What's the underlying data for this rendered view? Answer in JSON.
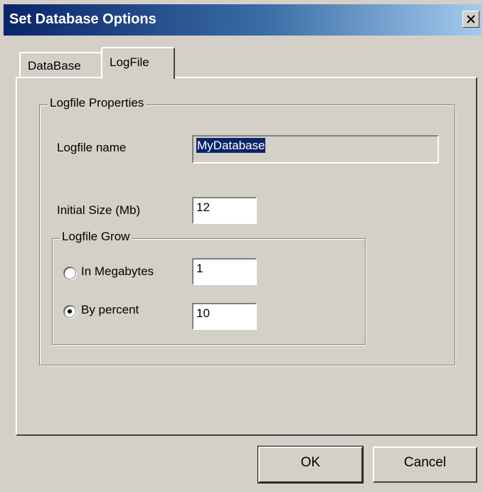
{
  "window": {
    "title": "Set Database Options",
    "close_glyph": "×"
  },
  "tabs": [
    {
      "label": "DataBase",
      "active": false
    },
    {
      "label": "LogFile",
      "active": true
    }
  ],
  "logfile_properties": {
    "group_label": "Logfile Properties",
    "name_label": "Logfile name",
    "name_value": "MyDatabase",
    "size_label": "Initial Size (Mb)",
    "size_value": "12"
  },
  "logfile_grow": {
    "group_label": "Logfile Grow",
    "options": [
      {
        "label": "In Megabytes",
        "value": "1",
        "selected": false
      },
      {
        "label": "By percent",
        "value": "10",
        "selected": true
      }
    ]
  },
  "buttons": {
    "ok": "OK",
    "cancel": "Cancel"
  },
  "colors": {
    "titlebar_start": "#0a246a",
    "titlebar_end": "#a6caf0",
    "face": "#d4d0c8",
    "selection": "#0a246a"
  }
}
